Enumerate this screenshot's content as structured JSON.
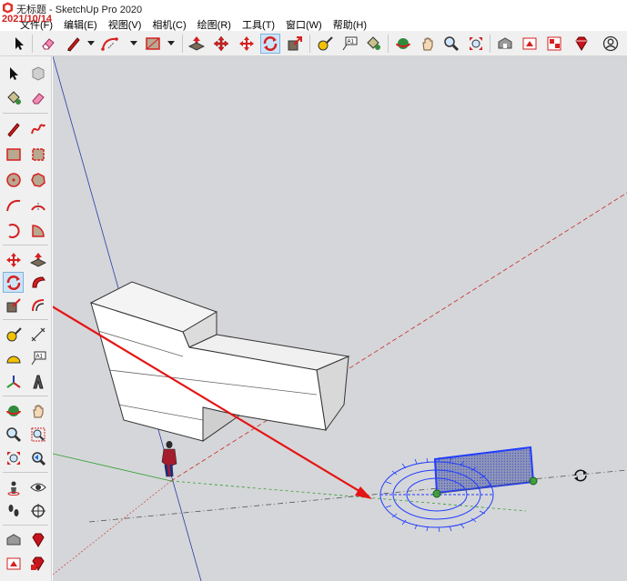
{
  "window": {
    "title": "无标题 - SketchUp Pro 2020",
    "watermark": "2021/10/14"
  },
  "menus": [
    "文件(F)",
    "编辑(E)",
    "视图(V)",
    "相机(C)",
    "绘图(R)",
    "工具(T)",
    "窗口(W)",
    "帮助(H)"
  ],
  "toolbar": {
    "active_tool": "rotate"
  },
  "left_toolbar": {
    "active_tool": "rotate"
  },
  "colors": {
    "viewport_bg": "#d5d6d9",
    "selection_blue": "#1f3cff",
    "annotation_red": "#e51414",
    "axis_red": "#c62828",
    "axis_green": "#2e9d2e",
    "axis_blue": "#2a3aa8"
  }
}
